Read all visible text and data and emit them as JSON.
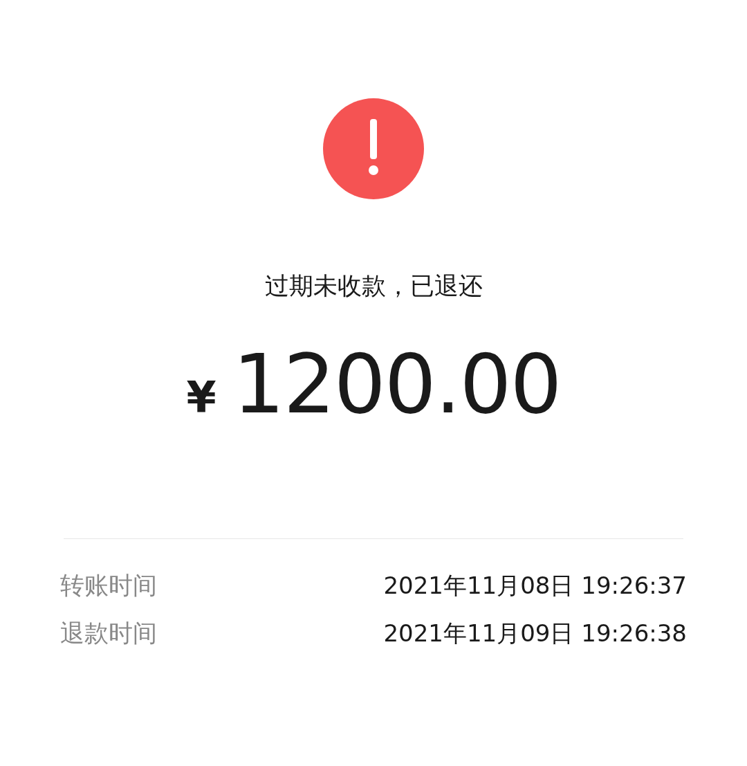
{
  "status": {
    "kind": "warning",
    "message": "过期未收款，已退还"
  },
  "amount": {
    "currency": "¥",
    "value": "1200.00"
  },
  "details": [
    {
      "label": "转账时间",
      "value": "2021年11月08日 19:26:37"
    },
    {
      "label": "退款时间",
      "value": "2021年11月09日 19:26:38"
    }
  ]
}
